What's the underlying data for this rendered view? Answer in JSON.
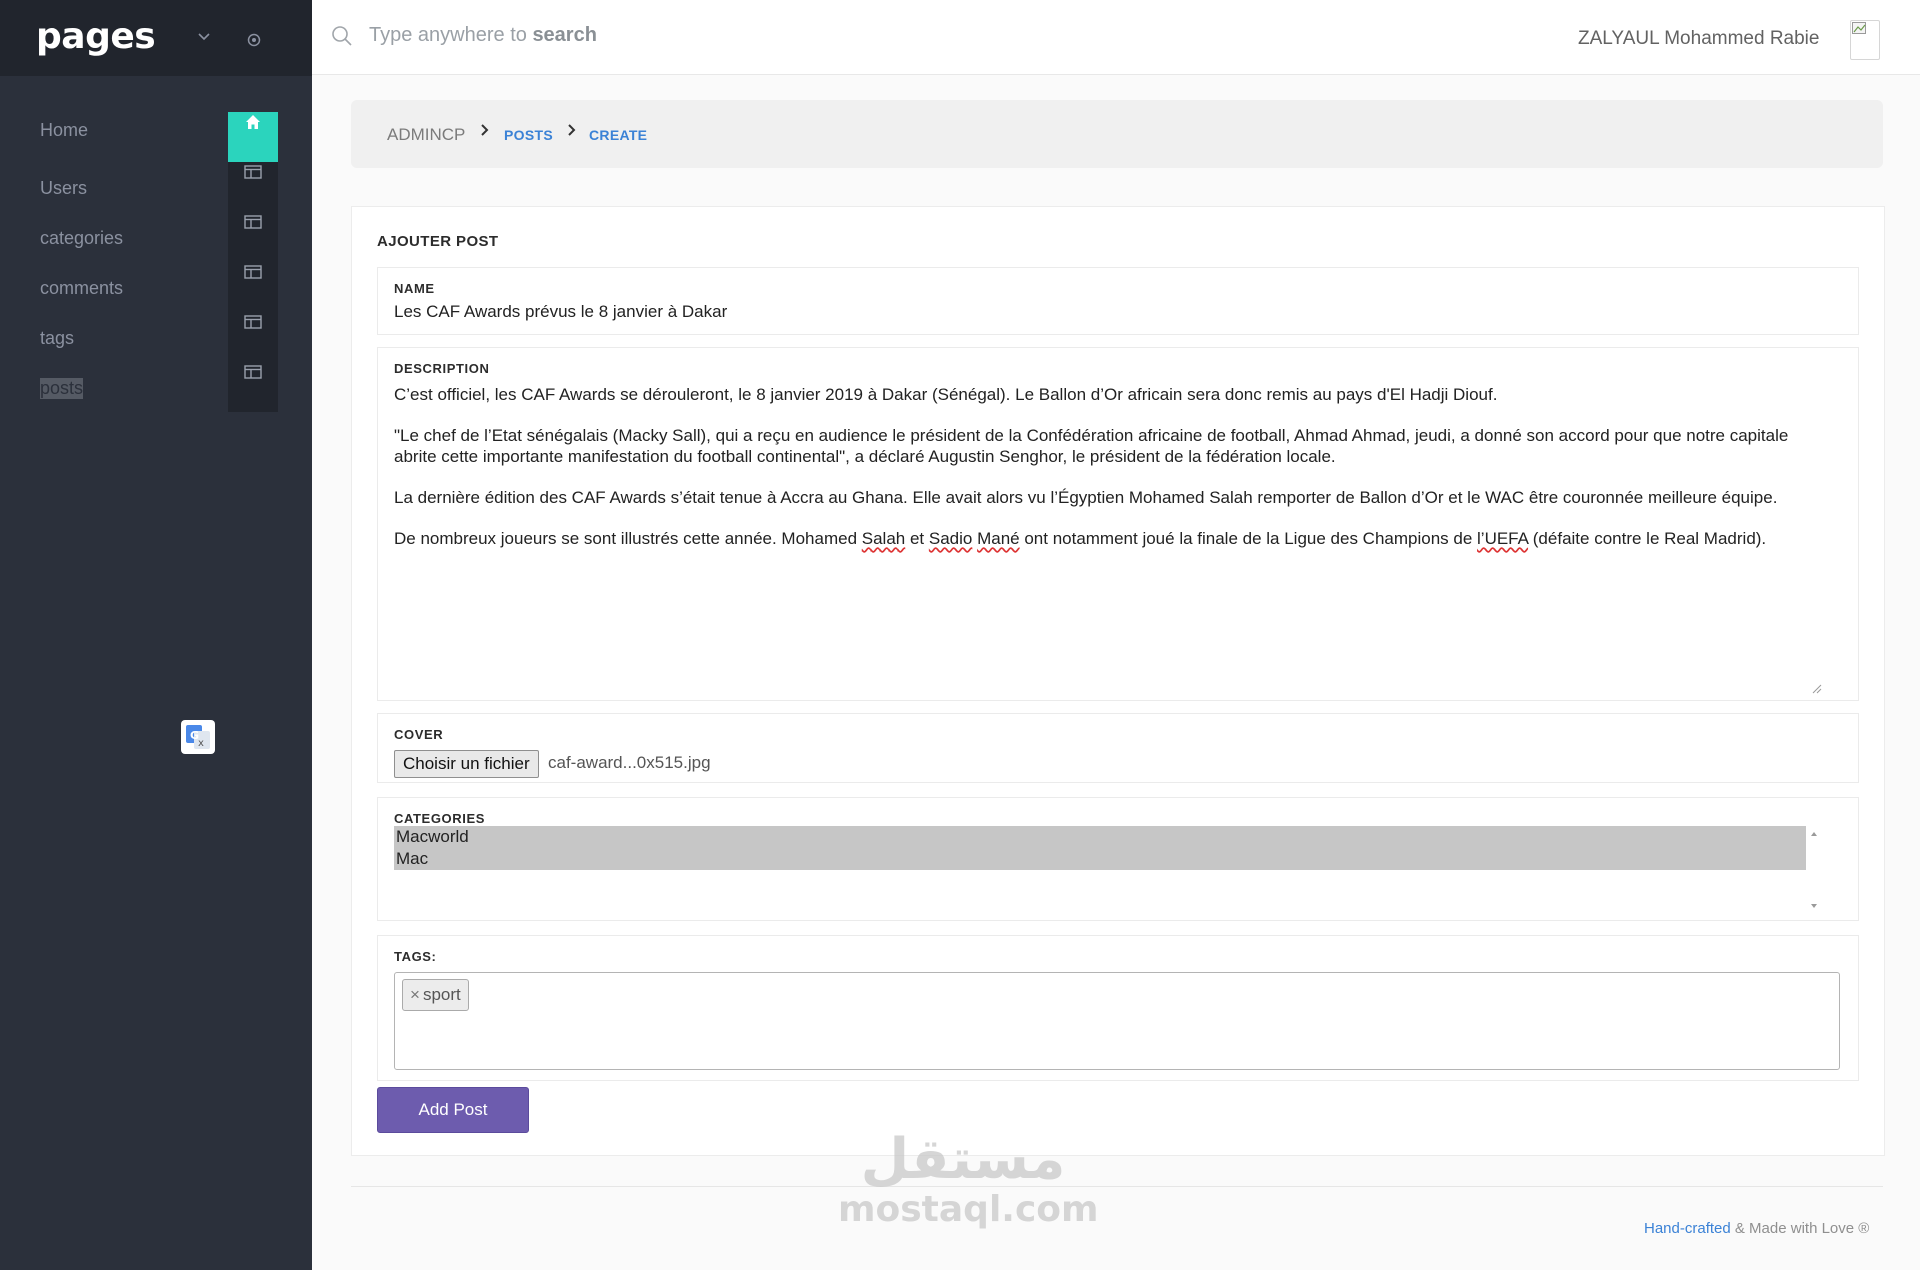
{
  "sidebar": {
    "brand": "pages",
    "items": [
      {
        "label": "Home"
      },
      {
        "label": "Users"
      },
      {
        "label": "categories"
      },
      {
        "label": "comments"
      },
      {
        "label": "tags"
      },
      {
        "label": "posts"
      }
    ],
    "active_color": "#2bd4bd"
  },
  "topbar": {
    "search_placeholder_prefix": "Type anywhere to",
    "search_placeholder_bold": "search",
    "username": "ZALYAUL Mohammed Rabie"
  },
  "breadcrumb": {
    "home": "ADMINCP",
    "level1": "POSTS",
    "level2": "CREATE"
  },
  "form": {
    "title": "AJOUTER POST",
    "name": {
      "label": "NAME",
      "value": "Les CAF Awards prévus le 8 janvier à Dakar"
    },
    "description": {
      "label": "DESCRIPTION",
      "p1": "C’est officiel, les CAF Awards se dérouleront, le 8 janvier 2019 à Dakar (Sénégal). Le Ballon d’Or africain sera donc remis au pays d'El Hadji Diouf.",
      "p2": "\"Le chef de l’Etat sénégalais (Macky Sall), qui a reçu en audience le président de la Confédération africaine de football, Ahmad Ahmad, jeudi, a donné son accord pour que notre capitale abrite cette importante manifestation du football continental\", a déclaré Augustin Senghor, le président de la fédération locale.",
      "p3": "La dernière édition des CAF Awards s’était tenue à Accra au Ghana. Elle avait alors vu l’Égyptien Mohamed Salah remporter de Ballon d’Or et le WAC être couronnée meilleure équipe.",
      "p4_a": "De nombreux joueurs se sont illustrés cette année. Mohamed ",
      "p4_salah": "Salah",
      "p4_b": " et ",
      "p4_sadio": "Sadio",
      "p4_c": " ",
      "p4_mane": "Mané",
      "p4_d": " ont notamment joué la finale de la Ligue des Champions de ",
      "p4_uefa": "l’UEFA",
      "p4_e": " (défaite contre le Real Madrid)."
    },
    "cover": {
      "label": "COVER",
      "button": "Choisir un fichier",
      "file_name": "caf-award...0x515.jpg"
    },
    "categories": {
      "label": "CATEGORIES",
      "options": [
        "Macworld",
        "Mac"
      ]
    },
    "tags": {
      "label": "TAGS:",
      "chips": [
        "sport"
      ]
    },
    "submit": "Add Post",
    "accent_color": "#6d5cae"
  },
  "footer": {
    "link": "Hand-crafted",
    "text": " & Made with Love ®"
  },
  "watermark": {
    "arabic": "مستقل",
    "latin": "mostaql.com"
  }
}
